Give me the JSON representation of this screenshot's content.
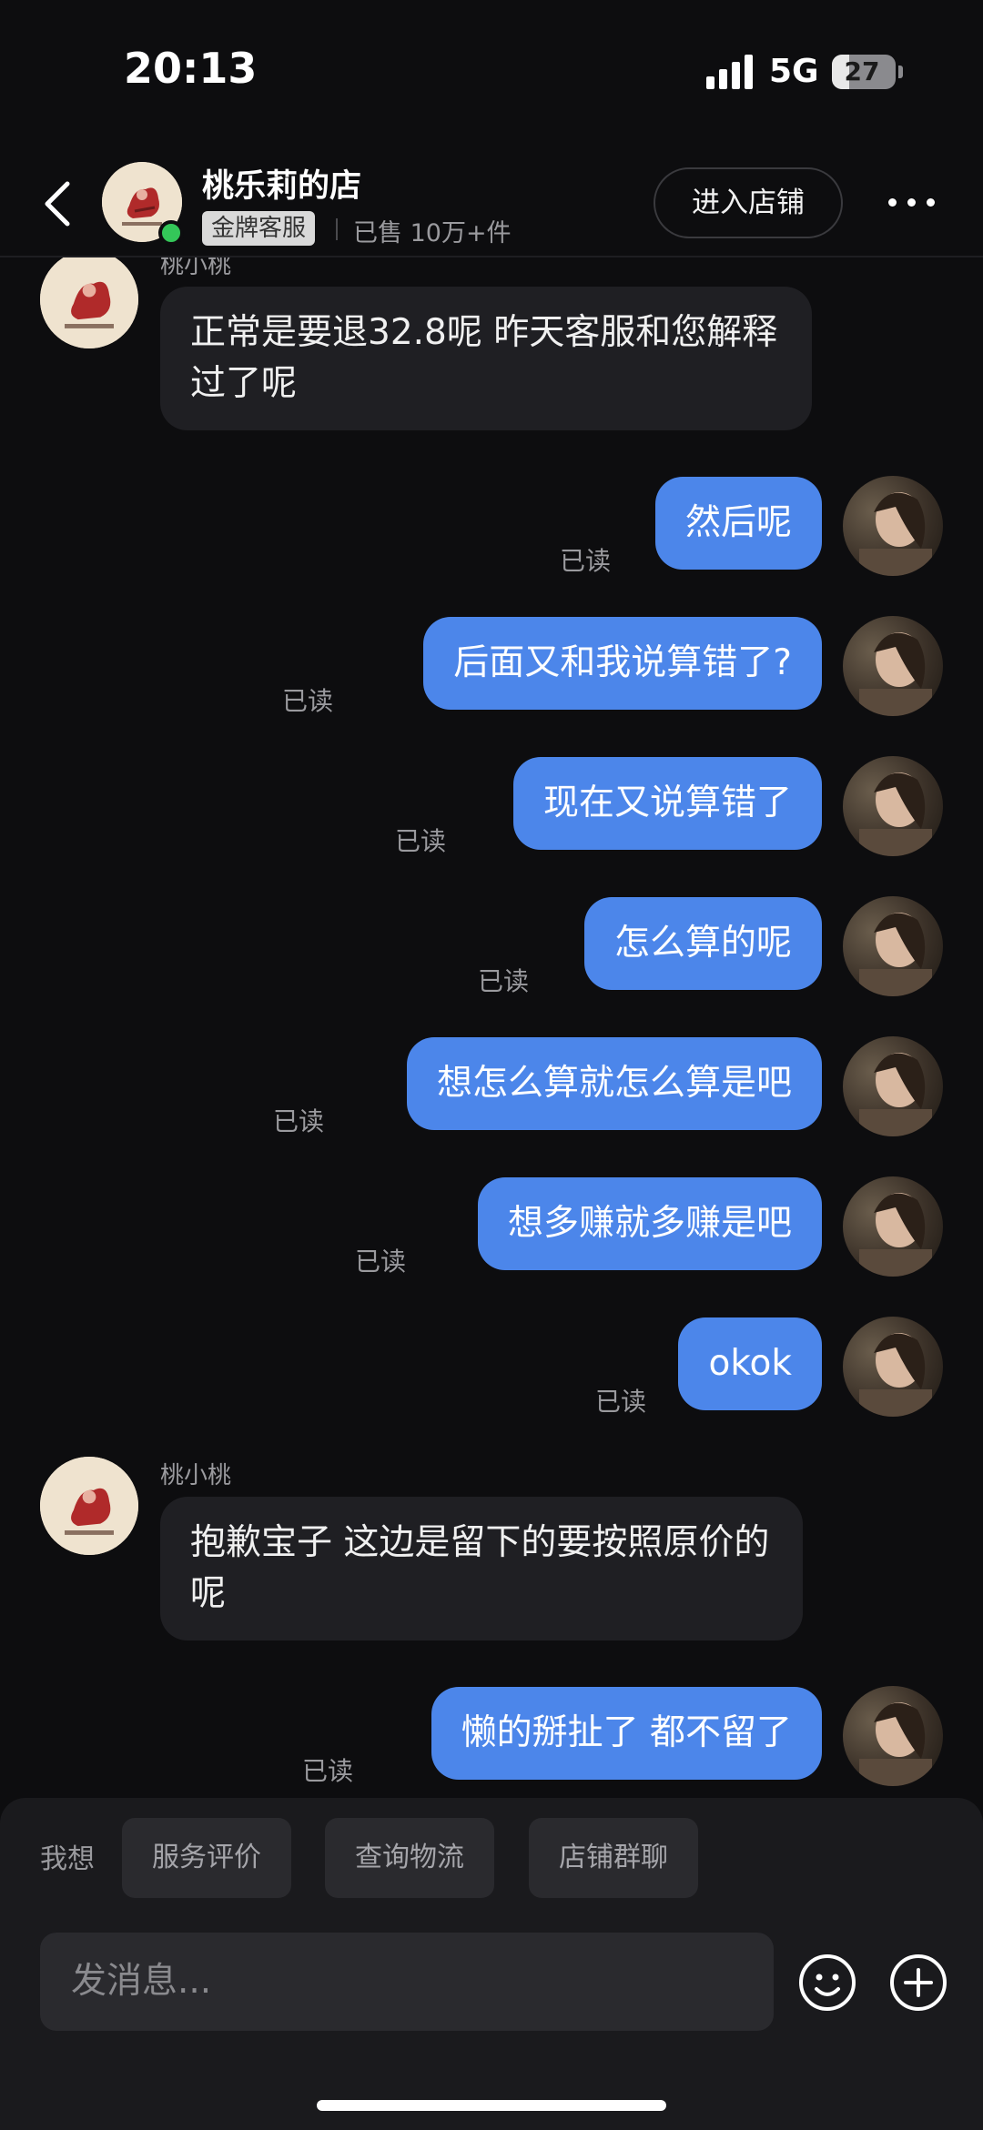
{
  "status_bar": {
    "time": "20:13",
    "network": "5G",
    "battery": "27",
    "battery_level": 0.27
  },
  "header": {
    "back_icon": "chevron-left-icon",
    "shop_name": "桃乐莉的店",
    "badge": "金牌客服",
    "sold": "已售 10万+件",
    "enter_store": "进入店铺",
    "more_icon": "more-dots-icon",
    "online_color": "#34c759"
  },
  "chat": {
    "agent_name": "桃小桃",
    "read_label": "已读",
    "messages": [
      {
        "from": "agent",
        "text": "正常是要退32.8呢 昨天客服和您解释过了呢"
      },
      {
        "from": "user",
        "text": "然后呢",
        "status": "已读"
      },
      {
        "from": "user",
        "text": "后面又和我说算错了?",
        "status": "已读"
      },
      {
        "from": "user",
        "text": "现在又说算错了",
        "status": "已读"
      },
      {
        "from": "user",
        "text": "怎么算的呢",
        "status": "已读"
      },
      {
        "from": "user",
        "text": "想怎么算就怎么算是吧",
        "status": "已读"
      },
      {
        "from": "user",
        "text": "想多赚就多赚是吧",
        "status": "已读"
      },
      {
        "from": "user",
        "text": "okok",
        "status": "已读"
      },
      {
        "from": "agent",
        "text": "抱歉宝子 这边是留下的要按照原价的呢"
      },
      {
        "from": "user",
        "text": "懒的掰扯了 都不留了",
        "status": "已读"
      }
    ],
    "bubble_out_color": "#4c86ea",
    "bubble_in_color": "#1f1f23"
  },
  "quick_bar": {
    "label": "我想",
    "chips": [
      "服务评价",
      "查询物流",
      "店铺群聊"
    ]
  },
  "composer": {
    "placeholder": "发消息...",
    "emoji_icon": "smiley-icon",
    "plus_icon": "plus-circle-icon"
  }
}
